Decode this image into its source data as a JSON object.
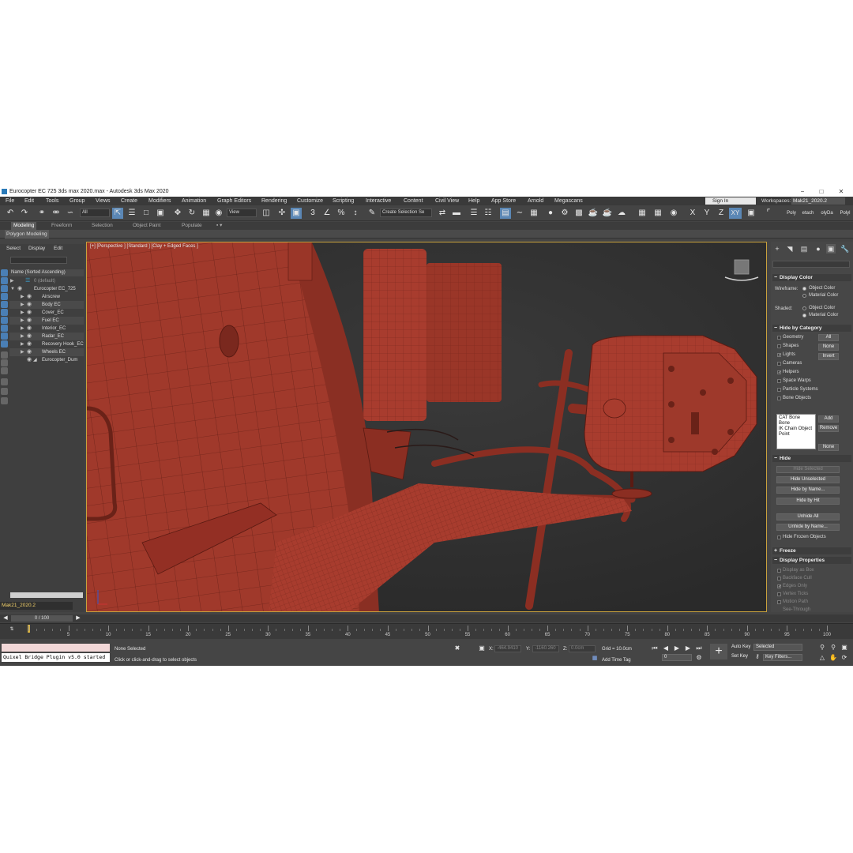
{
  "window": {
    "title": "Eurocopter EC 725 3ds max 2020.max - Autodesk 3ds Max 2020",
    "controls": [
      "−",
      "□",
      "✕"
    ]
  },
  "menubar": {
    "items": [
      "File",
      "Edit",
      "Tools",
      "Group",
      "Views",
      "Create",
      "Modifiers",
      "Animation",
      "Graph Editors",
      "Rendering",
      "Customize",
      "Scripting",
      "Interactive",
      "Content",
      "Civil View",
      "Help",
      "App Store",
      "Arnold",
      "Megascans"
    ],
    "sign_in": "Sign In",
    "workspaces_label": "Workspaces:",
    "workspace_value": "Mak21_2020.2"
  },
  "toolbar": {
    "selection_filter": "All",
    "ref_coord": "View",
    "named_selection_placeholder": "Create Selection Se",
    "axis_x": "X",
    "axis_y": "Y",
    "axis_z": "Z",
    "axis_xy": "XY",
    "right_tabs": [
      "Poly",
      "etach",
      "olyDa",
      "Polyl"
    ]
  },
  "ribbon": {
    "tabs": [
      "Modeling",
      "Freeform",
      "Selection",
      "Object Paint",
      "Populate"
    ],
    "active_tab": "Modeling",
    "panel": "Polygon Modeling"
  },
  "scene_explorer": {
    "menu": [
      "Select",
      "Display",
      "Edit"
    ],
    "column_header": "Name (Sorted Ascending)",
    "rows": [
      {
        "label": "0 (default)",
        "level": 1
      },
      {
        "label": "Eurocopter EC_725",
        "level": 1
      },
      {
        "label": "Airscrew",
        "level": 2
      },
      {
        "label": "Body EC",
        "level": 2
      },
      {
        "label": "Cover_EC",
        "level": 2
      },
      {
        "label": "Fuel EC",
        "level": 2
      },
      {
        "label": "Interior_EC",
        "level": 2
      },
      {
        "label": "Radar_EC",
        "level": 2
      },
      {
        "label": "Recovery Hook_EC",
        "level": 2
      },
      {
        "label": "Wheels EC",
        "level": 2
      },
      {
        "label": "Eurocopter_Dum",
        "level": 2
      }
    ],
    "status_layer": "Mak21_2020.2"
  },
  "viewport": {
    "label": "[+] [Perspective ] [Standard ] [Clay + Edged Faces ]",
    "model_color": "#a0392b",
    "edge_color": "#5a1a12"
  },
  "command_panel": {
    "display_color": {
      "title": "Display Color",
      "wireframe_label": "Wireframe:",
      "shaded_label": "Shaded:",
      "object_color": "Object Color",
      "material_color": "Material Color"
    },
    "hide_by_category": {
      "title": "Hide by Category",
      "items": [
        {
          "label": "Geometry",
          "checked": false
        },
        {
          "label": "Shapes",
          "checked": false
        },
        {
          "label": "Lights",
          "checked": true
        },
        {
          "label": "Cameras",
          "checked": false
        },
        {
          "label": "Helpers",
          "checked": true
        },
        {
          "label": "Space Warps",
          "checked": false
        },
        {
          "label": "Particle Systems",
          "checked": false
        },
        {
          "label": "Bone Objects",
          "checked": false
        }
      ],
      "btn_all": "All",
      "btn_none": "None",
      "btn_invert": "Invert",
      "list": [
        "CAT Bone",
        "Bone",
        "IK Chain Object",
        "Point"
      ],
      "btn_add": "Add",
      "btn_remove": "Remove",
      "btn_none2": "None"
    },
    "hide": {
      "title": "Hide",
      "buttons": [
        "Hide Selected",
        "Hide Unselected",
        "Hide by Name...",
        "Hide by Hit",
        "Unhide All",
        "Unhide by Name..."
      ],
      "frozen_label": "Hide Frozen Objects"
    },
    "freeze": {
      "title": "Freeze"
    },
    "display_properties": {
      "title": "Display Properties",
      "items": [
        "Display as Box",
        "Backface Cull",
        "Edges Only",
        "Vertex Ticks",
        "Motion Path",
        "See-Through"
      ]
    }
  },
  "timeline": {
    "slider": "0 / 100",
    "ticks": [
      "5",
      "10",
      "15",
      "20",
      "25",
      "30",
      "35",
      "40",
      "45",
      "50",
      "55",
      "60",
      "65",
      "70",
      "75",
      "80",
      "85",
      "90",
      "95",
      "100"
    ]
  },
  "status": {
    "maxscript_output": "Quixel Bridge Plugin v5.0 started",
    "selection": "None Selected",
    "prompt": "Click or click-and-drag to select objects",
    "x_label": "X:",
    "x_value": "-464.9410",
    "y_label": "Y:",
    "y_value": "-1160.260",
    "z_label": "Z:",
    "z_value": "0.0cm",
    "grid": "Grid = 10.0cm",
    "add_time_tag": "Add Time Tag",
    "auto_key": "Auto Key",
    "set_key": "Set Key",
    "key_mode": "Selected",
    "key_filters": "Key Filters...",
    "frame": "0"
  }
}
